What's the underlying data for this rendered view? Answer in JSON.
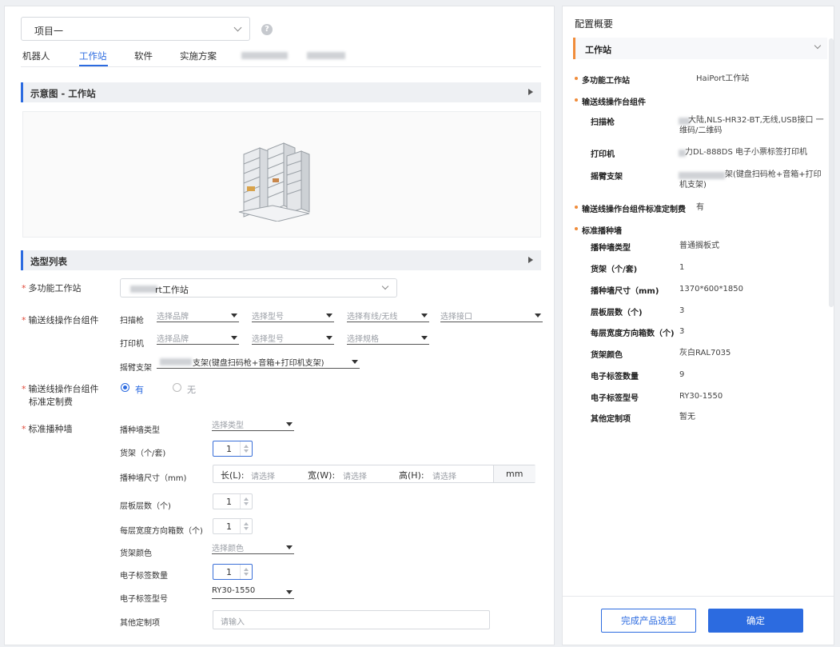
{
  "project_select": {
    "value": "项目一",
    "help": "?"
  },
  "tabs": [
    "机器人",
    "工作站",
    "软件",
    "实施方案"
  ],
  "schematic": {
    "title": "示意图 - 工作站"
  },
  "selection": {
    "title": "选型列表",
    "workstation": {
      "label": "多功能工作站",
      "value": "rt工作站"
    },
    "conveyor": {
      "label": "输送线操作台组件",
      "scanner": {
        "label": "扫描枪",
        "brand_ph": "选择品牌",
        "model_ph": "选择型号",
        "wired_ph": "选择有线/无线",
        "iface_ph": "选择接口"
      },
      "printer": {
        "label": "打印机",
        "brand_ph": "选择品牌",
        "model_ph": "选择型号",
        "spec_ph": "选择规格"
      },
      "arm": {
        "label": "摇臂支架",
        "value": "支架(键盘扫码枪+音箱+打印机支架)"
      }
    },
    "custom_fee": {
      "label_1": "输送线操作台组件",
      "label_2": "标准定制费",
      "yes": "有",
      "no": "无"
    },
    "wall": {
      "label": "标准播种墙",
      "type": {
        "label": "播种墙类型",
        "ph": "选择类型"
      },
      "shelf": {
        "label": "货架（个/套)",
        "value": "1"
      },
      "size": {
        "label": "播种墙尺寸（mm)",
        "l_label": "长(L):",
        "w_label": "宽(W):",
        "h_label": "高(H):",
        "ph": "请选择",
        "unit": "mm"
      },
      "layers": {
        "label": "层板层数（个)",
        "value": "1"
      },
      "boxes": {
        "label": "每层宽度方向箱数（个)",
        "value": "1"
      },
      "color": {
        "label": "货架颜色",
        "ph": "选择颜色"
      },
      "tag_count": {
        "label": "电子标签数量",
        "value": "1"
      },
      "tag_model": {
        "label": "电子标签型号",
        "value": "RY30-1550"
      },
      "other": {
        "label": "其他定制项",
        "ph": "请输入"
      }
    }
  },
  "summary": {
    "title": "配置概要",
    "group": "工作站",
    "workstation": {
      "label": "多功能工作站",
      "value": "HaiPort工作站"
    },
    "conveyor": {
      "label": "输送线操作台组件",
      "scanner": {
        "label": "扫描枪",
        "value_1": "大陆,NLS-HR32-BT,无线,USB接口 一",
        "value_2": "维码/二维码"
      },
      "printer": {
        "label": "打印机",
        "value": "力DL-888DS 电子小票标签打印机"
      },
      "arm": {
        "label": "摇臂支架",
        "value_1": "架(键盘扫码枪+音箱+打印",
        "value_2": "机支架)"
      }
    },
    "custom_fee": {
      "label": "输送线操作台组件标准定制费",
      "value": "有"
    },
    "wall": {
      "label": "标准播种墙",
      "rows": [
        {
          "label": "播种墙类型",
          "value": "普通搁板式"
        },
        {
          "label": "货架（个/套)",
          "value": "1"
        },
        {
          "label": "播种墙尺寸（mm)",
          "value": "1370*600*1850"
        },
        {
          "label": "层板层数（个)",
          "value": "3"
        },
        {
          "label": "每层宽度方向箱数（个)",
          "value": "3"
        },
        {
          "label": "货架颜色",
          "value": "灰白RAL7035"
        },
        {
          "label": "电子标签数量",
          "value": "9"
        },
        {
          "label": "电子标签型号",
          "value": "RY30-1550"
        },
        {
          "label": "其他定制项",
          "value": "暂无"
        }
      ]
    }
  },
  "actions": {
    "finish": "完成产品选型",
    "confirm": "确定"
  }
}
